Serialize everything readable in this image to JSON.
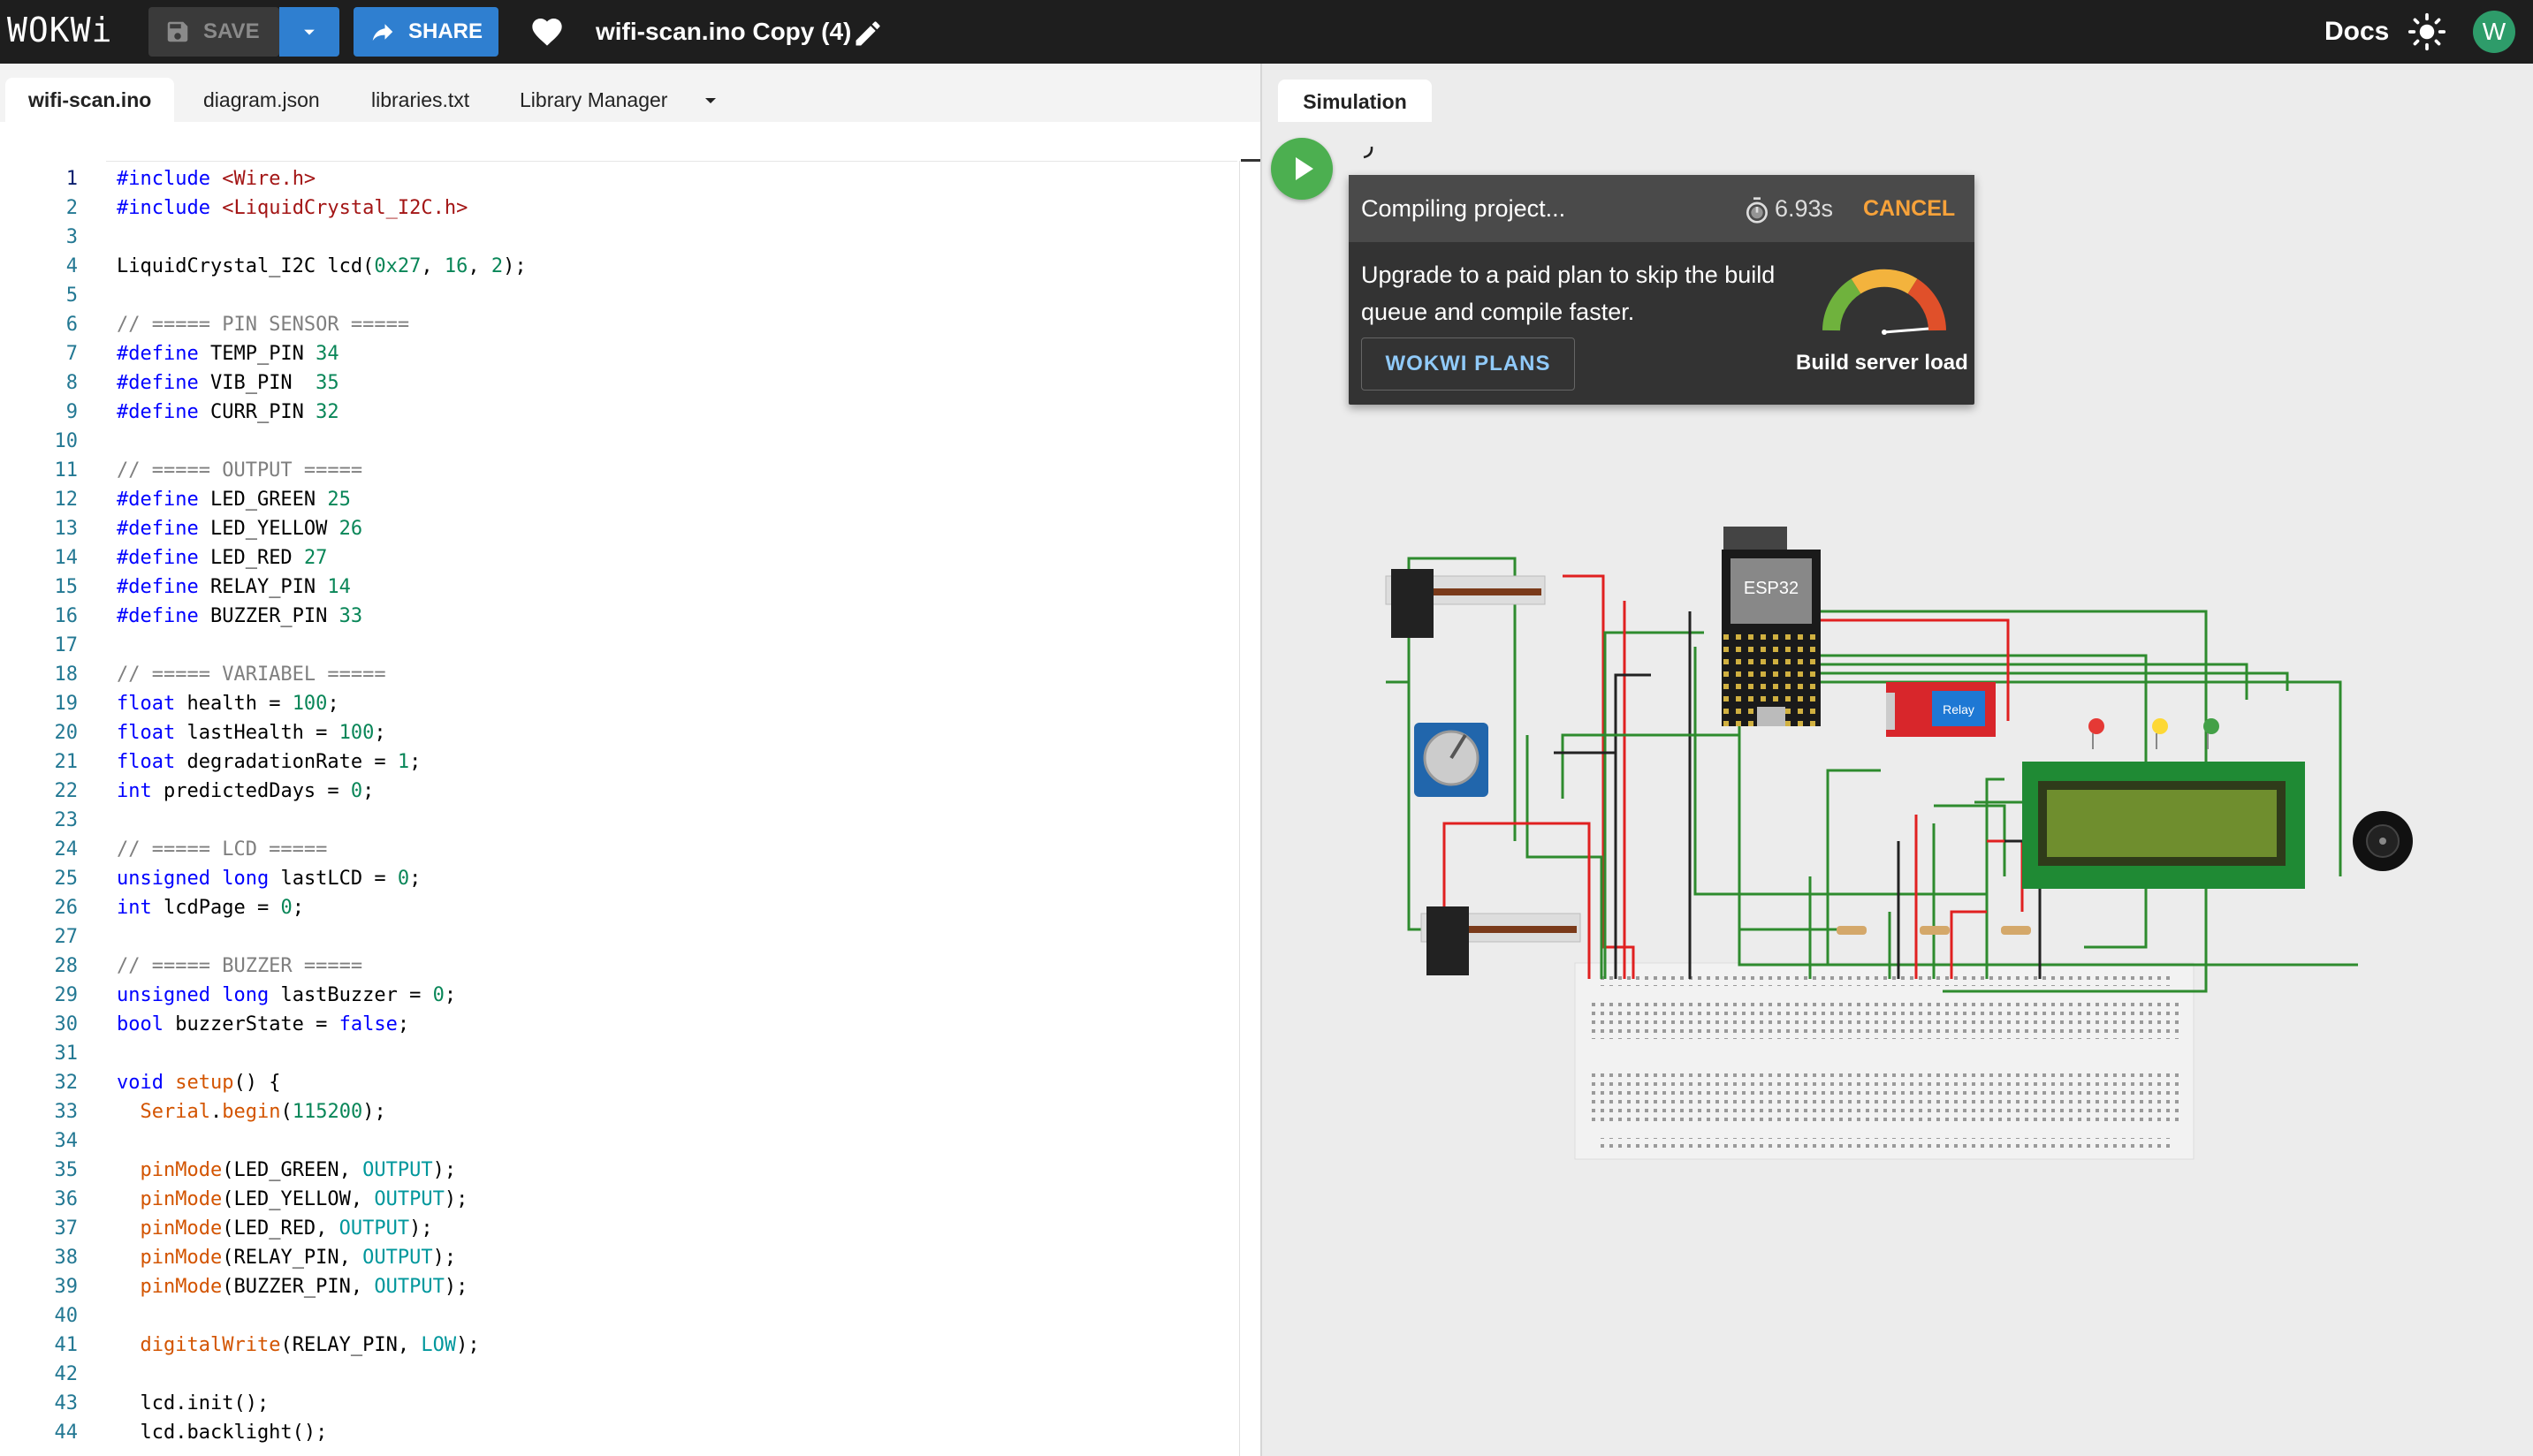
{
  "topbar": {
    "logo": "WOKWi",
    "save_label": "SAVE",
    "share_label": "SHARE",
    "project_title": "wifi-scan.ino Copy (4)",
    "docs_label": "Docs",
    "avatar_initial": "W"
  },
  "editor": {
    "tabs": [
      {
        "label": "wifi-scan.ino",
        "active": true
      },
      {
        "label": "diagram.json"
      },
      {
        "label": "libraries.txt"
      },
      {
        "label": "Library Manager"
      }
    ],
    "current_line": 1,
    "lines": [
      "#include <Wire.h>",
      "#include <LiquidCrystal_I2C.h>",
      "",
      "LiquidCrystal_I2C lcd(0x27, 16, 2);",
      "",
      "// ===== PIN SENSOR =====",
      "#define TEMP_PIN 34",
      "#define VIB_PIN  35",
      "#define CURR_PIN 32",
      "",
      "// ===== OUTPUT =====",
      "#define LED_GREEN 25",
      "#define LED_YELLOW 26",
      "#define LED_RED 27",
      "#define RELAY_PIN 14",
      "#define BUZZER_PIN 33",
      "",
      "// ===== VARIABEL =====",
      "float health = 100;",
      "float lastHealth = 100;",
      "float degradationRate = 1;",
      "int predictedDays = 0;",
      "",
      "// ===== LCD =====",
      "unsigned long lastLCD = 0;",
      "int lcdPage = 0;",
      "",
      "// ===== BUZZER =====",
      "unsigned long lastBuzzer = 0;",
      "bool buzzerState = false;",
      "",
      "void setup() {",
      "  Serial.begin(115200);",
      "",
      "  pinMode(LED_GREEN, OUTPUT);",
      "  pinMode(LED_YELLOW, OUTPUT);",
      "  pinMode(LED_RED, OUTPUT);",
      "  pinMode(RELAY_PIN, OUTPUT);",
      "  pinMode(BUZZER_PIN, OUTPUT);",
      "",
      "  digitalWrite(RELAY_PIN, LOW);",
      "",
      "  lcd.init();",
      "  lcd.backlight();"
    ]
  },
  "simulation": {
    "tab_label": "Simulation",
    "compile": {
      "status": "Compiling project...",
      "elapsed": "6.93s",
      "cancel_label": "CANCEL",
      "upgrade_message": "Upgrade to a paid plan to skip the build queue and compile faster.",
      "plans_button": "WOKWI PLANS",
      "gauge_label": "Build server load"
    },
    "parts": {
      "esp32_label": "ESP32",
      "relay_label": "Relay"
    }
  },
  "colors": {
    "topbar_bg": "#1e1e1e",
    "accent_blue": "#2f7fd0",
    "play_green": "#4caf50",
    "cancel_orange": "#f7a23a",
    "wire_green": "#2e8b2e",
    "wire_red": "#e02020"
  }
}
